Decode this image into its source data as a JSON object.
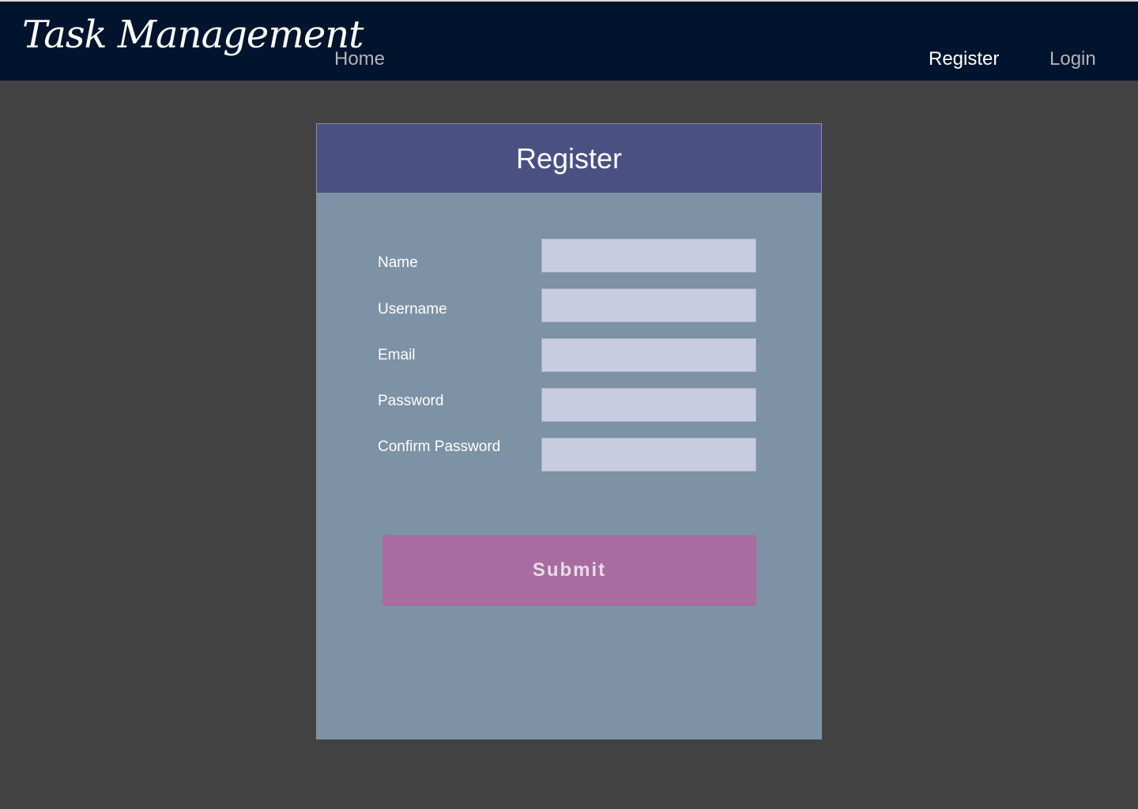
{
  "navbar": {
    "brand": "Task Management",
    "links": [
      {
        "label": "Home"
      },
      {
        "label": "Register"
      },
      {
        "label": "Login"
      }
    ],
    "active": "Register"
  },
  "form": {
    "title": "Register",
    "fields": [
      {
        "label": "Name",
        "value": ""
      },
      {
        "label": "Username",
        "value": ""
      },
      {
        "label": "Email",
        "value": ""
      },
      {
        "label": "Password",
        "value": ""
      },
      {
        "label": "Confirm Password",
        "value": ""
      }
    ],
    "submit_label": "Submit"
  },
  "colors": {
    "page_background": "#424242",
    "navbar_background": "#01142e",
    "card_background": "#7d92a5",
    "card_header": "#4a5081",
    "input_background": "#c7cce1",
    "submit_button": "#a86ca1"
  }
}
